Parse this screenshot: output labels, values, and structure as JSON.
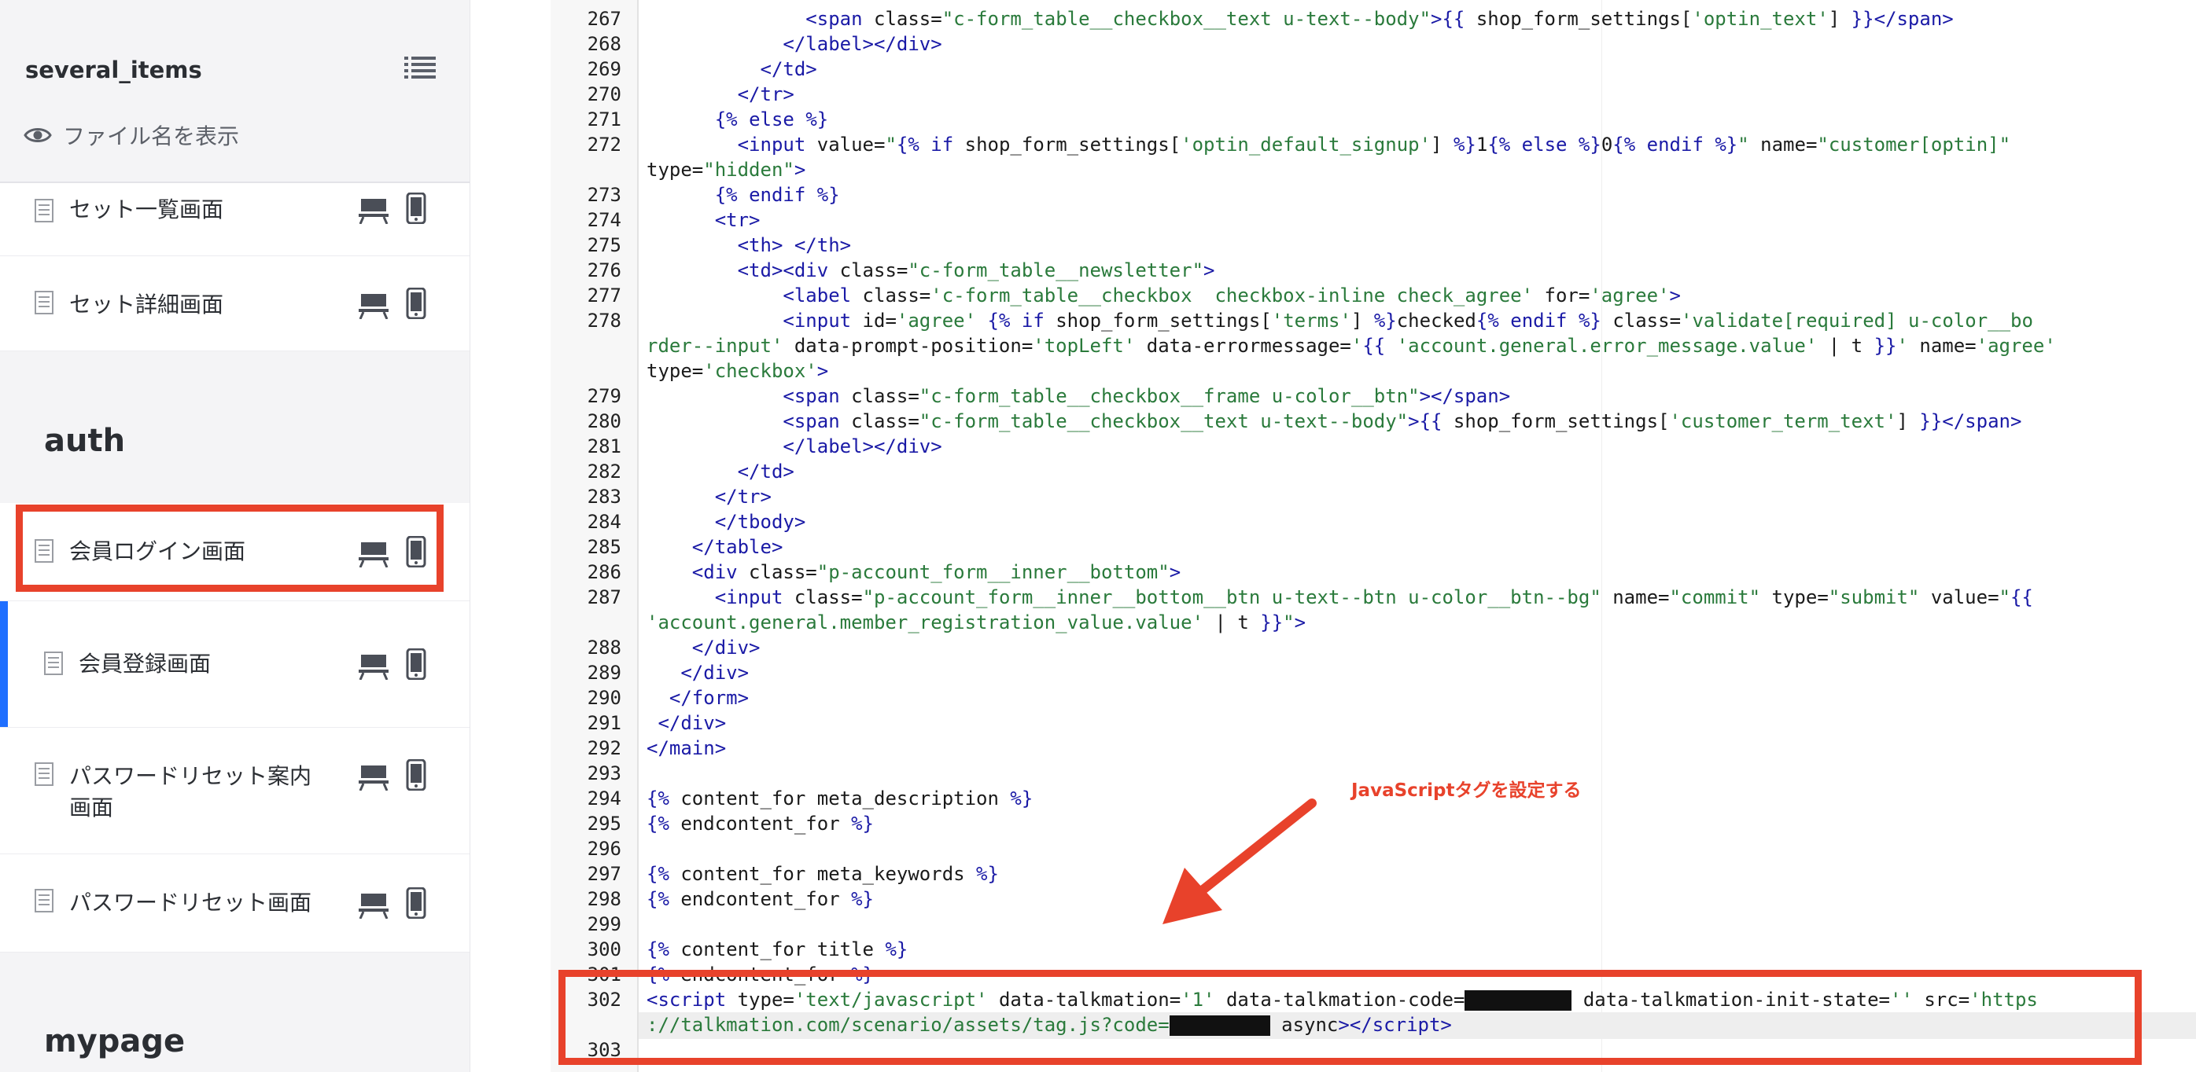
{
  "sidebar": {
    "project_name": "several_items",
    "show_filename_label": "ファイル名を表示",
    "items": [
      {
        "label": "セット一覧画面"
      },
      {
        "label": "セット詳細画面"
      },
      {
        "label": "会員ログイン画面"
      },
      {
        "label": "会員登録画面"
      },
      {
        "label": "パスワードリセット案内画面"
      },
      {
        "label": "パスワードリセット画面"
      }
    ],
    "sections": {
      "auth": "auth",
      "mypage": "mypage"
    }
  },
  "editor": {
    "lines": [
      {
        "n": "267",
        "html": "              <span class=\"tag\">&lt;span</span> <span class=\"txt\">class</span>=<span class=\"str\">\"c-form_table__checkbox__text u-text--body\"</span><span class=\"tag\">&gt;</span><span class=\"liq\">{{</span> shop_form_settings[<span class=\"str\">'optin_text'</span>] <span class=\"liq\">}}</span><span class=\"tag\">&lt;/span&gt;</span>"
      },
      {
        "n": "268",
        "html": "            <span class=\"tag\">&lt;/label&gt;&lt;/div&gt;</span>"
      },
      {
        "n": "269",
        "html": "          <span class=\"tag\">&lt;/td&gt;</span>"
      },
      {
        "n": "270",
        "html": "        <span class=\"tag\">&lt;/tr&gt;</span>"
      },
      {
        "n": "271",
        "html": "      <span class=\"liq\">{%</span> <span class=\"liq\">else</span> <span class=\"liq\">%}</span>"
      },
      {
        "n": "272",
        "html": "        <span class=\"tag\">&lt;input</span> <span class=\"txt\">value</span>=<span class=\"str\">\"</span><span class=\"liq\">{%</span> <span class=\"liq\">if</span> shop_form_settings[<span class=\"str\">'optin_default_signup'</span>] <span class=\"liq\">%}</span>1<span class=\"liq\">{%</span> <span class=\"liq\">else</span> <span class=\"liq\">%}</span>0<span class=\"liq\">{%</span> <span class=\"liq\">endif</span> <span class=\"liq\">%}</span><span class=\"str\">\"</span> <span class=\"txt\">name</span>=<span class=\"str\">\"customer[optin]\"</span>"
      },
      {
        "n": "",
        "html": "<span class=\"txt\">type</span>=<span class=\"str\">\"hidden\"</span><span class=\"tag\">&gt;</span>"
      },
      {
        "n": "273",
        "html": "      <span class=\"liq\">{%</span> <span class=\"liq\">endif</span> <span class=\"liq\">%}</span>"
      },
      {
        "n": "274",
        "html": "      <span class=\"tag\">&lt;tr&gt;</span>"
      },
      {
        "n": "275",
        "html": "        <span class=\"tag\">&lt;th&gt;</span> <span class=\"tag\">&lt;/th&gt;</span>"
      },
      {
        "n": "276",
        "html": "        <span class=\"tag\">&lt;td&gt;&lt;div</span> <span class=\"txt\">class</span>=<span class=\"str\">\"c-form_table__newsletter\"</span><span class=\"tag\">&gt;</span>"
      },
      {
        "n": "277",
        "html": "            <span class=\"tag\">&lt;label</span> <span class=\"txt\">class</span>=<span class=\"str\">'c-form_table__checkbox  checkbox-inline check_agree'</span> <span class=\"txt\">for</span>=<span class=\"str\">'agree'</span><span class=\"tag\">&gt;</span>"
      },
      {
        "n": "278",
        "html": "            <span class=\"tag\">&lt;input</span> <span class=\"txt\">id</span>=<span class=\"str\">'agree'</span> <span class=\"liq\">{%</span> <span class=\"liq\">if</span> shop_form_settings[<span class=\"str\">'terms'</span>] <span class=\"liq\">%}</span>checked<span class=\"liq\">{%</span> <span class=\"liq\">endif</span> <span class=\"liq\">%}</span> <span class=\"txt\">class</span>=<span class=\"str\">'validate[required] u-color__bo</span>"
      },
      {
        "n": "",
        "html": "<span class=\"str\">rder--input'</span> <span class=\"txt\">data-prompt-position</span>=<span class=\"str\">'topLeft'</span> <span class=\"txt\">data-errormessage</span>=<span class=\"str\">'</span><span class=\"liq\">{{</span> <span class=\"str\">'account.general.error_message.value'</span> | t <span class=\"liq\">}}</span><span class=\"str\">'</span> <span class=\"txt\">name</span>=<span class=\"str\">'agree'</span>"
      },
      {
        "n": "",
        "html": "<span class=\"txt\">type</span>=<span class=\"str\">'checkbox'</span><span class=\"tag\">&gt;</span>"
      },
      {
        "n": "279",
        "html": "            <span class=\"tag\">&lt;span</span> <span class=\"txt\">class</span>=<span class=\"str\">\"c-form_table__checkbox__frame u-color__btn\"</span><span class=\"tag\">&gt;&lt;/span&gt;</span>"
      },
      {
        "n": "280",
        "html": "            <span class=\"tag\">&lt;span</span> <span class=\"txt\">class</span>=<span class=\"str\">\"c-form_table__checkbox__text u-text--body\"</span><span class=\"tag\">&gt;</span><span class=\"liq\">{{</span> shop_form_settings[<span class=\"str\">'customer_term_text'</span>] <span class=\"liq\">}}</span><span class=\"tag\">&lt;/span&gt;</span>"
      },
      {
        "n": "281",
        "html": "            <span class=\"tag\">&lt;/label&gt;&lt;/div&gt;</span>"
      },
      {
        "n": "282",
        "html": "        <span class=\"tag\">&lt;/td&gt;</span>"
      },
      {
        "n": "283",
        "html": "      <span class=\"tag\">&lt;/tr&gt;</span>"
      },
      {
        "n": "284",
        "html": "      <span class=\"tag\">&lt;/tbody&gt;</span>"
      },
      {
        "n": "285",
        "html": "    <span class=\"tag\">&lt;/table&gt;</span>"
      },
      {
        "n": "286",
        "html": "    <span class=\"tag\">&lt;div</span> <span class=\"txt\">class</span>=<span class=\"str\">\"p-account_form__inner__bottom\"</span><span class=\"tag\">&gt;</span>"
      },
      {
        "n": "287",
        "html": "      <span class=\"tag\">&lt;input</span> <span class=\"txt\">class</span>=<span class=\"str\">\"p-account_form__inner__bottom__btn u-text--btn u-color__btn--bg\"</span> <span class=\"txt\">name</span>=<span class=\"str\">\"commit\"</span> <span class=\"txt\">type</span>=<span class=\"str\">\"submit\"</span> <span class=\"txt\">value</span>=<span class=\"str\">\"</span><span class=\"liq\">{{</span>"
      },
      {
        "n": "",
        "html": "<span class=\"str\">'account.general.member_registration_value.value'</span> | t <span class=\"liq\">}}</span><span class=\"str\">\"</span><span class=\"tag\">&gt;</span>"
      },
      {
        "n": "288",
        "html": "    <span class=\"tag\">&lt;/div&gt;</span>"
      },
      {
        "n": "289",
        "html": "   <span class=\"tag\">&lt;/div&gt;</span>"
      },
      {
        "n": "290",
        "html": "  <span class=\"tag\">&lt;/form&gt;</span>"
      },
      {
        "n": "291",
        "html": " <span class=\"tag\">&lt;/div&gt;</span>"
      },
      {
        "n": "292",
        "html": "<span class=\"tag\">&lt;/main&gt;</span>"
      },
      {
        "n": "293",
        "html": ""
      },
      {
        "n": "294",
        "html": "<span class=\"liq\">{%</span> content_for meta_description <span class=\"liq\">%}</span>"
      },
      {
        "n": "295",
        "html": "<span class=\"liq\">{%</span> endcontent_for <span class=\"liq\">%}</span>"
      },
      {
        "n": "296",
        "html": ""
      },
      {
        "n": "297",
        "html": "<span class=\"liq\">{%</span> content_for meta_keywords <span class=\"liq\">%}</span>"
      },
      {
        "n": "298",
        "html": "<span class=\"liq\">{%</span> endcontent_for <span class=\"liq\">%}</span>"
      },
      {
        "n": "299",
        "html": ""
      },
      {
        "n": "300",
        "html": "<span class=\"liq\">{%</span> content_for title <span class=\"liq\">%}</span>"
      },
      {
        "n": "301",
        "html": "<span class=\"liq\">{%</span> endcontent_for <span class=\"liq\">%}</span>"
      },
      {
        "n": "302",
        "html": "<span class=\"tag\">&lt;script</span> <span class=\"txt\">type</span>=<span class=\"str\">'text/javascript'</span> <span class=\"txt\">data-talkmation</span>=<span class=\"str\">'1'</span> <span class=\"txt\">data-talkmation-code</span>=<span class=\"redacted\" style=\"width:136px\"></span> <span class=\"txt\">data-talkmation-init-state</span>=<span class=\"str\">''</span> <span class=\"txt\">src</span>=<span class=\"str\">'https</span>"
      },
      {
        "n": "",
        "html": "<span class=\"str\">://talkmation.com/scenario/assets/tag.js?code=</span><span class=\"redacted\" style=\"width:128px\"></span> <span class=\"txt\">async</span><span class=\"tag\">&gt;&lt;/script&gt;</span>"
      },
      {
        "n": "303",
        "html": ""
      }
    ]
  },
  "annotation": {
    "text": "JavaScriptタグを設定する",
    "color": "#e8422b"
  },
  "colors": {
    "accent": "#1f6fff",
    "highlight": "#e8422b"
  }
}
